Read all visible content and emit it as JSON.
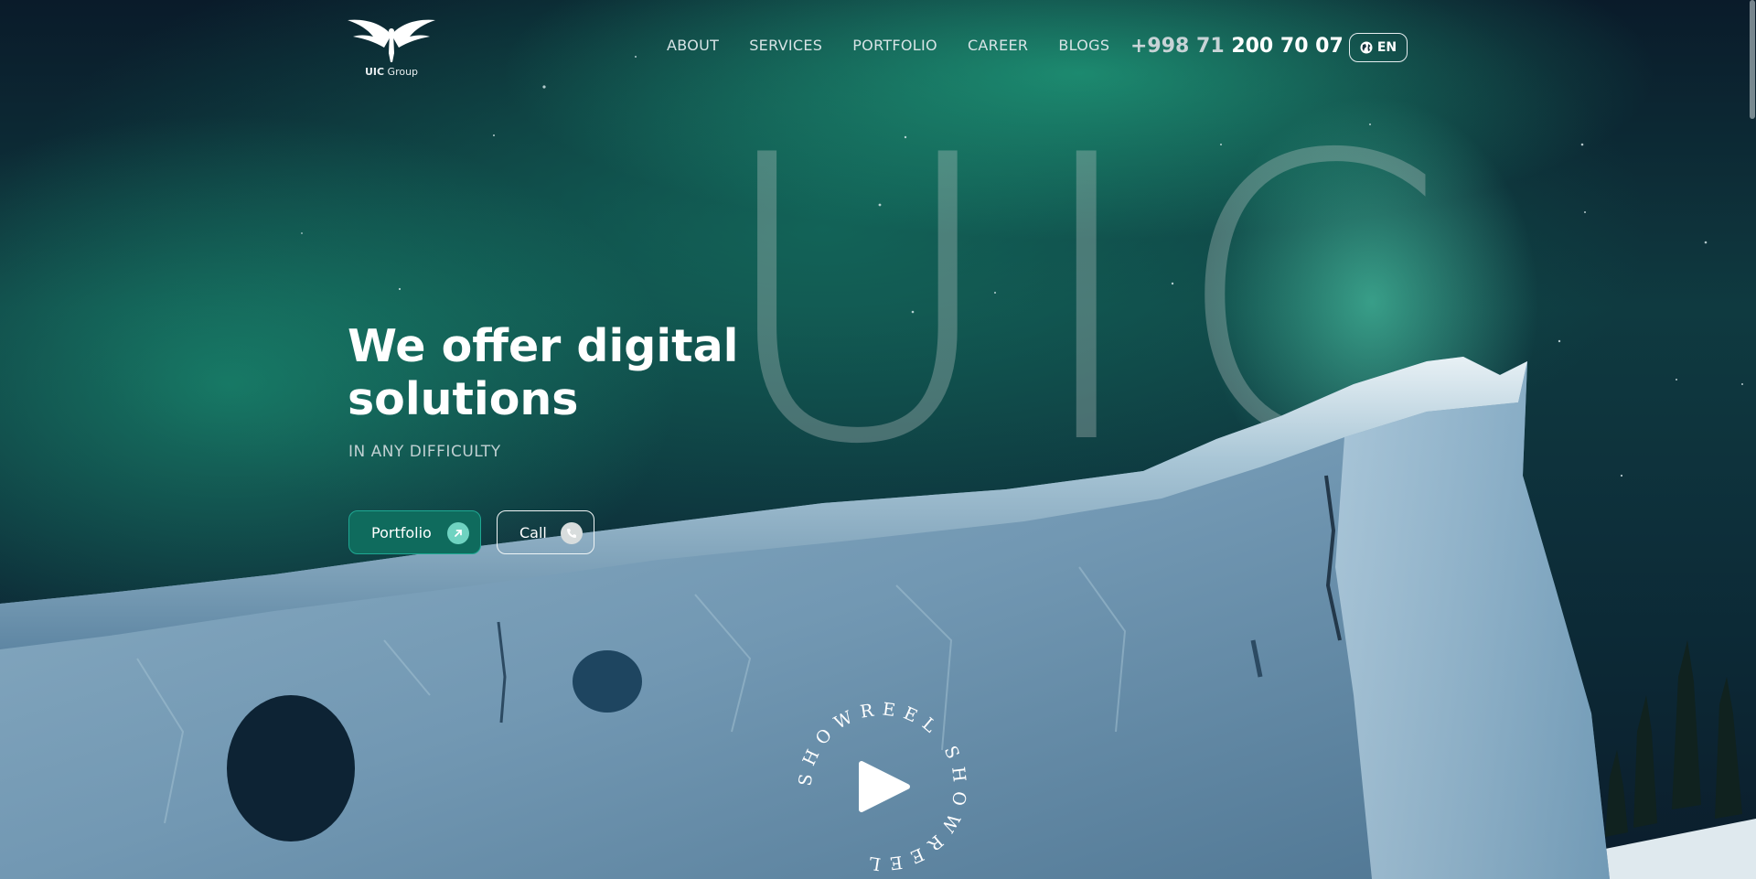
{
  "header": {
    "logo": {
      "brand": "UIC",
      "suffix": "Group",
      "icon": "winged-pegasus-logo"
    },
    "nav": [
      {
        "label": "ABOUT"
      },
      {
        "label": "SERVICES"
      },
      {
        "label": "PORTFOLIO"
      },
      {
        "label": "CAREER"
      },
      {
        "label": "BLOGS"
      }
    ],
    "phone": {
      "code": "+998 71",
      "number": "200 70 07"
    },
    "language": {
      "label": "EN",
      "icon": "globe-icon"
    }
  },
  "hero": {
    "watermark": "UIC",
    "title": "We offer digital solutions",
    "subtitle": "IN ANY DIFFICULTY",
    "buttons": {
      "portfolio": {
        "label": "Portfolio",
        "icon": "arrow-up-right-icon"
      },
      "call": {
        "label": "Call",
        "icon": "phone-icon"
      }
    }
  },
  "showreel": {
    "ring_text": "SHOWREEL SHOWREEL ",
    "icon": "play-icon"
  },
  "colors": {
    "accent": "#0f6b5d",
    "accent_border": "#1fa893",
    "aurora": "#2ac79a"
  }
}
